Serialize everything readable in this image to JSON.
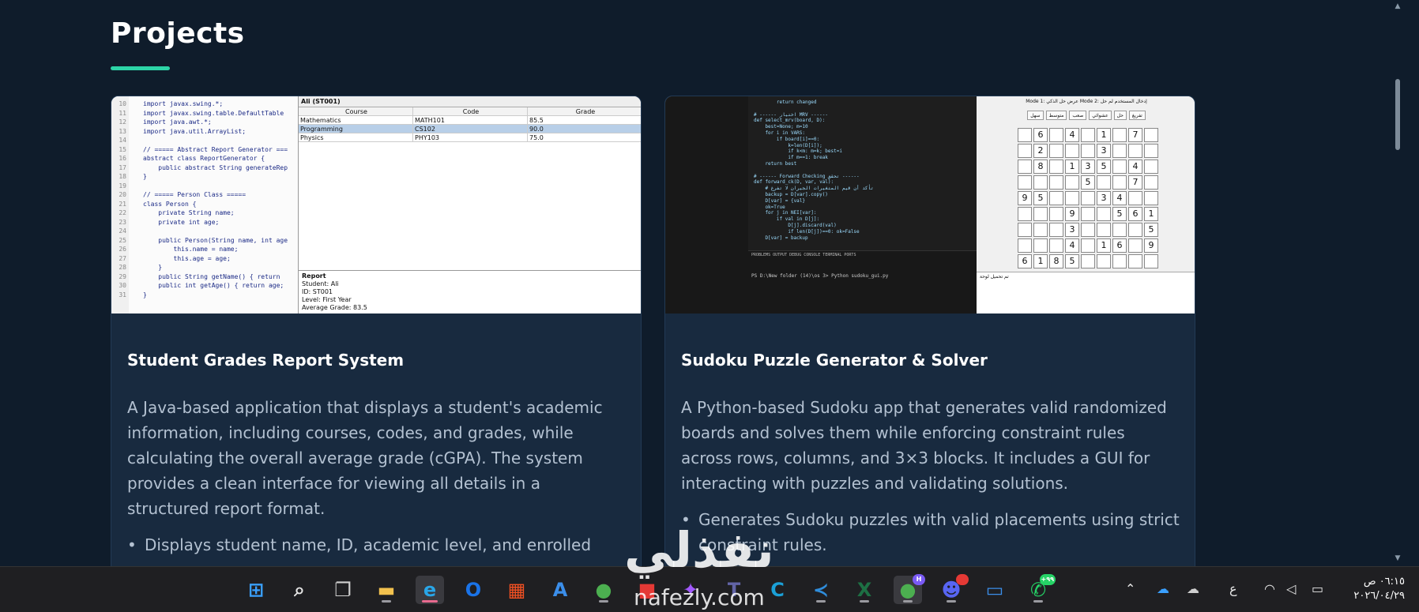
{
  "section": {
    "title": "Projects"
  },
  "projects": [
    {
      "title": "Student Grades Report System",
      "description": "A Java-based application that displays a student's academic information, including courses, codes, and grades, while calculating the overall average grade (cGPA). The system provides a clean interface for viewing all details in a structured report format.",
      "bullets": [
        "Displays student name, ID, academic level, and enrolled"
      ],
      "screenshot": {
        "code_lines": [
          "import javax.swing.*;",
          "import javax.swing.table.DefaultTable",
          "import java.awt.*;",
          "import java.util.ArrayList;",
          "",
          "// ===== Abstract Report Generator ===",
          "abstract class ReportGenerator {",
          "    public abstract String generateRep",
          "}",
          "",
          "// ===== Person Class =====",
          "class Person {",
          "    private String name;",
          "    private int age;",
          "",
          "    public Person(String name, int age",
          "        this.name = name;",
          "        this.age = age;",
          "    }",
          "    public String getName() { return ",
          "    public int getAge() { return age;",
          "}"
        ],
        "line_numbers": [
          "10",
          "11",
          "12",
          "13",
          "14",
          "15",
          "16",
          "17",
          "18",
          "19",
          "20",
          "21",
          "22",
          "23",
          "24",
          "25",
          "26",
          "27",
          "28",
          "29",
          "30",
          "31"
        ],
        "window_title": "Ali (ST001)",
        "table_headers": [
          "Course",
          "Code",
          "Grade"
        ],
        "table_rows": [
          [
            "Mathematics",
            "MATH101",
            "85.5"
          ],
          [
            "Programming",
            "CS102",
            "90.0"
          ],
          [
            "Physics",
            "PHY103",
            "75.0"
          ]
        ],
        "report_lines": [
          "Report",
          "Student: Ali",
          "ID: ST001",
          "Level: First Year",
          "Average Grade: 83.5"
        ]
      }
    },
    {
      "title": "Sudoku Puzzle Generator & Solver",
      "description": "A Python-based Sudoku app that generates valid randomized boards and solves them while enforcing constraint rules across rows, columns, and 3×3 blocks. It includes a GUI for interacting with puzzles and validating solutions.",
      "bullets": [
        "Generates Sudoku puzzles with valid placements using strict constraint rules."
      ],
      "screenshot": {
        "code_lines": [
          "        return changed",
          "",
          "# ------ اختيار MRV ------",
          "def select_mrv(board, D):",
          "    best=None; m=10",
          "    for i in VARS:",
          "        if board[i]==0:",
          "            k=len(D[i]);",
          "            if k<m: m=k; best=i",
          "            if m==1: break",
          "    return best",
          "",
          "# ------ Forward Checking تحقق ------",
          "def forward_ck(D, var, val):",
          "    # تأكد أن قيم المتغيرات الجيران لا تفرغ",
          "    backup = D[var].copy()",
          "    D[var] = {val}",
          "    ok=True",
          "    for j in NEI[var]:",
          "        if val in D[j]:",
          "            D[j].discard(val)",
          "            if len(D[j])==0: ok=False",
          "    D[var] = backup"
        ],
        "terminal_tabs": "PROBLEMS   OUTPUT   DEBUG CONSOLE   TERMINAL   PORTS",
        "terminal_line": "PS D:\\New folder (14)\\os 3> Python sudoku_gui.py",
        "modes": "Mode 1: عرض حل الذكي     Mode 2: إدخال المستخدم لم حل",
        "buttons": [
          "سهل",
          "متوسط",
          "صعب",
          "عشوائي",
          "حل",
          "تفريغ"
        ],
        "grid": [
          [
            "",
            "6",
            "",
            "4",
            "",
            "1",
            "",
            "7",
            ""
          ],
          [
            "",
            "2",
            "",
            "",
            "",
            "3",
            "",
            "",
            ""
          ],
          [
            "",
            "8",
            "",
            "1",
            "3",
            "5",
            "",
            "4",
            ""
          ],
          [
            "",
            "",
            "",
            "",
            "5",
            "",
            "",
            "7",
            ""
          ],
          [
            "9",
            "5",
            "",
            "",
            "",
            "3",
            "4",
            "",
            ""
          ],
          [
            "",
            "",
            "",
            "9",
            "",
            "",
            "5",
            "6",
            "1"
          ],
          [
            "",
            "",
            "",
            "3",
            "",
            "",
            "",
            "",
            "5"
          ],
          [
            "",
            "",
            "",
            "4",
            "",
            "1",
            "6",
            "",
            "9"
          ],
          [
            "6",
            "1",
            "8",
            "5",
            "",
            "",
            "",
            "",
            ""
          ]
        ],
        "status": "تم تحميل لوحة"
      }
    }
  ],
  "watermark": {
    "logo": "نفذلي",
    "url": "nafezly.com"
  },
  "taskbar": {
    "icons": [
      {
        "name": "windows-start-icon",
        "glyph": "⊞",
        "color": "#3aa0ff"
      },
      {
        "name": "search-icon",
        "glyph": "⌕",
        "color": "#e6e6e6"
      },
      {
        "name": "task-view-icon",
        "glyph": "❐",
        "color": "#d0d0d0"
      },
      {
        "name": "file-explorer-icon",
        "glyph": "▬",
        "color": "#f2c14e"
      },
      {
        "name": "edge-icon",
        "glyph": "e",
        "color": "#29a6e8"
      },
      {
        "name": "outlook-icon",
        "glyph": "O",
        "color": "#1a73e8"
      },
      {
        "name": "microsoft-store-icon",
        "glyph": "▦",
        "color": "#f25022"
      },
      {
        "name": "azure-data-studio-icon",
        "glyph": "A",
        "color": "#3b8eea"
      },
      {
        "name": "chrome-icon",
        "glyph": "●",
        "color": "#4caf50"
      },
      {
        "name": "app-icon-red",
        "glyph": "■",
        "color": "#e53935"
      },
      {
        "name": "figma-icon",
        "glyph": "✦",
        "color": "#a259ff"
      },
      {
        "name": "teams-icon",
        "glyph": "T",
        "color": "#6264a7"
      },
      {
        "name": "cisco-icon",
        "glyph": "C",
        "color": "#1ba0d7"
      },
      {
        "name": "vscode-icon",
        "glyph": "≺",
        "color": "#2f8ddb"
      },
      {
        "name": "excel-icon",
        "glyph": "X",
        "color": "#1d7044"
      },
      {
        "name": "chrome-profile-icon",
        "glyph": "●",
        "color": "#4caf50",
        "badge": "H",
        "badge_color": "#7a5af5"
      },
      {
        "name": "discord-icon",
        "glyph": "☻",
        "color": "#5865f2",
        "badge": "",
        "badge_color": "#e53935"
      },
      {
        "name": "remote-desktop-icon",
        "glyph": "▭",
        "color": "#3b8eea"
      },
      {
        "name": "whatsapp-icon",
        "glyph": "✆",
        "color": "#25d366",
        "badge": "+٩٩",
        "badge_color": "#25d366"
      }
    ],
    "tray": {
      "language": "ع",
      "time": "٠٦:١٥ ص",
      "date": "٢٠٢٦/٠٤/٢٩"
    }
  }
}
